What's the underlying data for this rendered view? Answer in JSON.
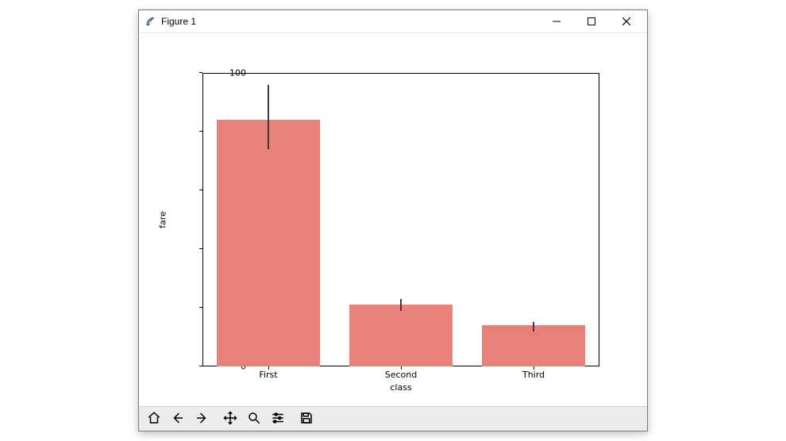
{
  "window": {
    "title": "Figure 1"
  },
  "toolbar": {
    "home": "Home",
    "back": "Back",
    "forward": "Forward",
    "pan": "Pan",
    "zoom": "Zoom",
    "configure": "Configure",
    "save": "Save"
  },
  "chart_data": {
    "type": "bar",
    "categories": [
      "First",
      "Second",
      "Third"
    ],
    "values": [
      84,
      21,
      14
    ],
    "error_bars": [
      {
        "low": 74,
        "high": 96
      },
      {
        "low": 19,
        "high": 23
      },
      {
        "low": 12,
        "high": 15
      }
    ],
    "xlabel": "class",
    "ylabel": "fare",
    "ylim": [
      0,
      100
    ],
    "yticks": [
      0,
      20,
      40,
      60,
      80,
      100
    ],
    "bar_color": "#e8817a"
  }
}
